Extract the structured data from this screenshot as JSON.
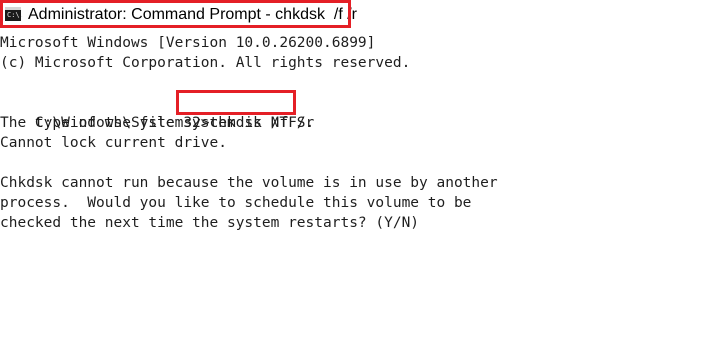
{
  "window": {
    "title": "Administrator: Command Prompt - chkdsk  /f /r",
    "icon": "cmd-icon",
    "icon_text": "C:\\."
  },
  "console": {
    "lines": [
      "Microsoft Windows [Version 10.0.26200.6899]",
      "(c) Microsoft Corporation. All rights reserved.",
      "",
      "",
      "The type of the file system is NTFS.",
      "Cannot lock current drive.",
      "",
      "Chkdsk cannot run because the volume is in use by another",
      "process.  Would you like to schedule this volume to be",
      "checked the next time the system restarts? (Y/N)"
    ],
    "prompt": "C:\\Windows\\System32>",
    "command": "chkdsk /f /r"
  },
  "colors": {
    "highlight": "#e41f26",
    "background": "#ffffff",
    "text": "#1e1e1e"
  }
}
